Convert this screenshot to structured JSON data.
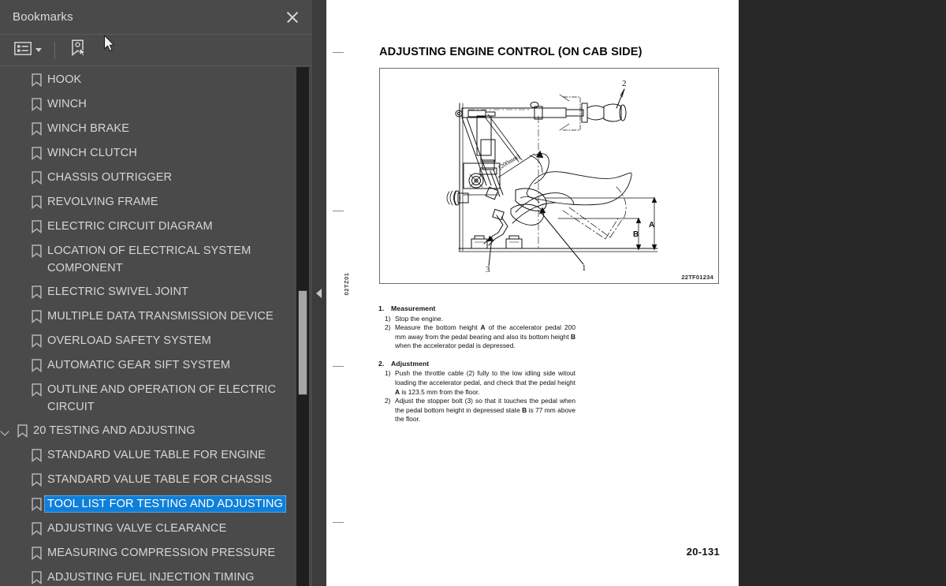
{
  "sidebar": {
    "title": "Bookmarks",
    "close_icon": "close-icon",
    "toolbar": {
      "list_options_icon": "list-options-icon",
      "new_bookmark_icon": "new-bookmark-icon",
      "dropdown_caret_icon": "chevron-down-icon"
    },
    "selection_color": "#0f7fd9",
    "items": [
      {
        "label": "HOOK",
        "level": 1,
        "expandable": false,
        "selected": false
      },
      {
        "label": "WINCH",
        "level": 1,
        "expandable": false,
        "selected": false
      },
      {
        "label": "WINCH BRAKE",
        "level": 1,
        "expandable": false,
        "selected": false
      },
      {
        "label": "WINCH CLUTCH",
        "level": 1,
        "expandable": false,
        "selected": false
      },
      {
        "label": "CHASSIS OUTRIGGER",
        "level": 1,
        "expandable": false,
        "selected": false
      },
      {
        "label": "REVOLVING FRAME",
        "level": 1,
        "expandable": false,
        "selected": false
      },
      {
        "label": "ELECTRIC CIRCUIT DIAGRAM",
        "level": 1,
        "expandable": false,
        "selected": false
      },
      {
        "label": "LOCATION OF ELECTRICAL SYSTEM COMPONENT",
        "level": 1,
        "expandable": false,
        "selected": false
      },
      {
        "label": "ELECTRIC SWIVEL JOINT",
        "level": 1,
        "expandable": false,
        "selected": false
      },
      {
        "label": "MULTIPLE DATA TRANSMISSION DEVICE",
        "level": 1,
        "expandable": false,
        "selected": false
      },
      {
        "label": "OVERLOAD SAFETY SYSTEM",
        "level": 1,
        "expandable": false,
        "selected": false
      },
      {
        "label": "AUTOMATIC GEAR SIFT SYSTEM",
        "level": 1,
        "expandable": false,
        "selected": false
      },
      {
        "label": "OUTLINE AND OPERATION OF ELECTRIC CIRCUIT",
        "level": 1,
        "expandable": false,
        "selected": false
      },
      {
        "label": "20 TESTING AND ADJUSTING",
        "level": 0,
        "expandable": true,
        "selected": false
      },
      {
        "label": "STANDARD VALUE TABLE FOR ENGINE",
        "level": 1,
        "expandable": false,
        "selected": false
      },
      {
        "label": "STANDARD VALUE TABLE FOR CHASSIS",
        "level": 1,
        "expandable": false,
        "selected": false
      },
      {
        "label": "TOOL LIST FOR TESTING AND ADJUSTING",
        "level": 1,
        "expandable": false,
        "selected": true
      },
      {
        "label": "ADJUSTING VALVE CLEARANCE",
        "level": 1,
        "expandable": false,
        "selected": false
      },
      {
        "label": "MEASURING COMPRESSION PRESSURE",
        "level": 1,
        "expandable": false,
        "selected": false
      },
      {
        "label": "ADJUSTING FUEL INJECTION TIMING",
        "level": 1,
        "expandable": false,
        "selected": false
      }
    ]
  },
  "splitter": {
    "collapse_icon": "collapse-left-arrow-icon"
  },
  "document": {
    "heading": "ADJUSTING ENGINE CONTROL (ON CAB SIDE)",
    "side_code": "02TZ01",
    "figure_code": "22TF01234",
    "figure_callouts": [
      "1",
      "2",
      "3",
      "A",
      "B",
      "(200mm)"
    ],
    "page_number": "20-131",
    "sections": [
      {
        "number": "1.",
        "title": "Measurement",
        "steps": [
          {
            "num": "1)",
            "text": "Stop the engine."
          },
          {
            "num": "2)",
            "text": "Measure the bottom height A of the accelerator pedal 200 mm away from the pedal bearing and also its bottom height B when the accelerator pedal is depressed."
          }
        ]
      },
      {
        "number": "2.",
        "title": "Adjustment",
        "steps": [
          {
            "num": "1)",
            "text": "Push the throttle cable (2) fully to the low idling side witout loading the accelerator pedal, and check that the pedal height A is 123.5 mm from the floor."
          },
          {
            "num": "2)",
            "text": "Adjust the stopper bolt (3) so that it touches the pedal when the pedal bottom height in depressed state B is 77 mm above the floor."
          }
        ]
      }
    ]
  }
}
